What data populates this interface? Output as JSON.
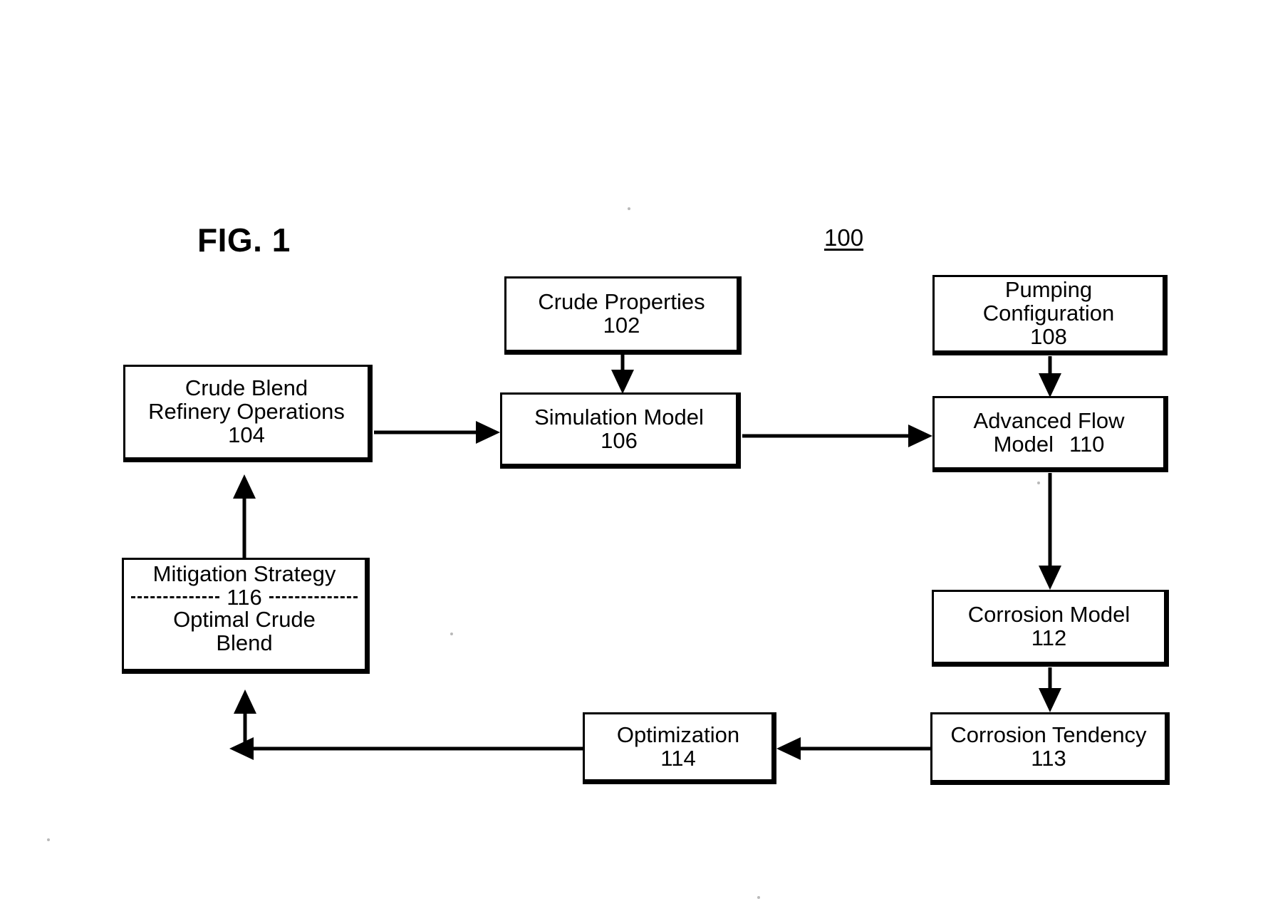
{
  "figure": {
    "title": "FIG. 1",
    "reference_numeral": "100"
  },
  "blocks": {
    "crude_properties": {
      "label": "Crude Properties",
      "number": "102"
    },
    "pumping_configuration": {
      "label_line1": "Pumping",
      "label_line2": "Configuration",
      "number": "108"
    },
    "crude_blend_refinery_operations": {
      "label_line1": "Crude Blend",
      "label_line2": "Refinery Operations",
      "number": "104"
    },
    "simulation_model": {
      "label": "Simulation Model",
      "number": "106"
    },
    "advanced_flow_model": {
      "label_line1": "Advanced Flow",
      "label_line2": "Model",
      "number": "110"
    },
    "mitigation_strategy": {
      "label_top": "Mitigation Strategy",
      "divider_number": "116",
      "label_bottom_line1": "Optimal Crude",
      "label_bottom_line2": "Blend"
    },
    "corrosion_model": {
      "label": "Corrosion Model",
      "number": "112"
    },
    "corrosion_tendency": {
      "label": "Corrosion Tendency",
      "number": "113"
    },
    "optimization": {
      "label": "Optimization",
      "number": "114"
    }
  },
  "connections": [
    {
      "name": "crude-properties-to-simulation-model",
      "from": "crude_properties",
      "to": "simulation_model",
      "direction": "down"
    },
    {
      "name": "pumping-configuration-to-advanced-flow-model",
      "from": "pumping_configuration",
      "to": "advanced_flow_model",
      "direction": "down"
    },
    {
      "name": "crude-blend-refinery-operations-to-simulation-model",
      "from": "crude_blend_refinery_operations",
      "to": "simulation_model",
      "direction": "right"
    },
    {
      "name": "simulation-model-to-advanced-flow-model",
      "from": "simulation_model",
      "to": "advanced_flow_model",
      "direction": "right"
    },
    {
      "name": "advanced-flow-model-to-corrosion-model",
      "from": "advanced_flow_model",
      "to": "corrosion_model",
      "direction": "down"
    },
    {
      "name": "corrosion-model-to-corrosion-tendency",
      "from": "corrosion_model",
      "to": "corrosion_tendency",
      "direction": "down"
    },
    {
      "name": "corrosion-tendency-to-optimization",
      "from": "corrosion_tendency",
      "to": "optimization",
      "direction": "left"
    },
    {
      "name": "optimization-to-mitigation-strategy",
      "from": "optimization",
      "to": "mitigation_strategy",
      "direction": "left-up"
    },
    {
      "name": "mitigation-strategy-to-crude-blend-refinery-operations",
      "from": "mitigation_strategy",
      "to": "crude_blend_refinery_operations",
      "direction": "up"
    }
  ],
  "style": {
    "ink_color": "#000000",
    "background_color": "#ffffff"
  }
}
